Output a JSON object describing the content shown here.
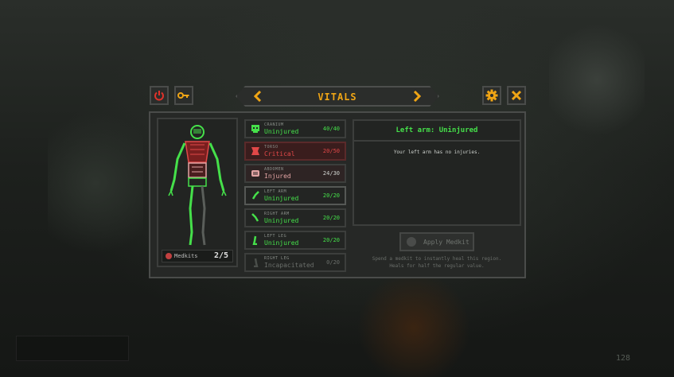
{
  "header": {
    "title": "VITALS",
    "prev_icon": "chevron-left-icon",
    "next_icon": "chevron-right-icon",
    "power_icon": "power-icon",
    "key_icon": "key-icon",
    "settings_icon": "gear-icon",
    "close_icon": "close-icon"
  },
  "body": {
    "medkits_label": "Medkits",
    "medkits_count": "2/5"
  },
  "regions": [
    {
      "name": "CRANIUM",
      "status": "Uninjured",
      "hp": "40/40",
      "state": "ok",
      "icon": "skull-icon"
    },
    {
      "name": "TORSO",
      "status": "Critical",
      "hp": "20/50",
      "state": "critical",
      "icon": "torso-icon"
    },
    {
      "name": "ABDOMEN",
      "status": "Injured",
      "hp": "24/30",
      "state": "injured",
      "icon": "abdomen-icon"
    },
    {
      "name": "LEFT ARM",
      "status": "Uninjured",
      "hp": "20/20",
      "state": "ok",
      "icon": "arm-icon"
    },
    {
      "name": "RIGHT ARM",
      "status": "Uninjured",
      "hp": "20/20",
      "state": "ok",
      "icon": "arm-icon"
    },
    {
      "name": "LEFT LEG",
      "status": "Uninjured",
      "hp": "20/20",
      "state": "ok",
      "icon": "leg-icon"
    },
    {
      "name": "RIGHT LEG",
      "status": "Incapacitated",
      "hp": "0/20",
      "state": "disabled",
      "icon": "leg-icon"
    }
  ],
  "detail": {
    "title": "Left arm: Uninjured",
    "description": "Your left arm has no injuries.",
    "apply_label": "Apply Medkit",
    "hint_line1": "Spend a medkit to instantly heal this region.",
    "hint_line2": "Heals for half the regular value."
  },
  "hud": {
    "ammo": "128"
  },
  "colors": {
    "accent": "#f0a515",
    "ok": "#45e04a",
    "critical": "#e04848",
    "injured": "#e2a4a4",
    "danger_button": "#e0322a"
  }
}
